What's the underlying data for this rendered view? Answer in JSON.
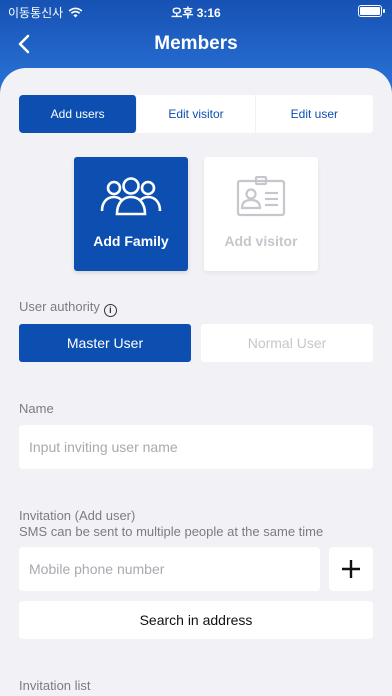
{
  "status_bar": {
    "carrier": "이동통신사",
    "time": "오후 3:16"
  },
  "header": {
    "title": "Members"
  },
  "tabs": [
    {
      "label": "Add users",
      "active": true
    },
    {
      "label": "Edit visitor",
      "active": false
    },
    {
      "label": "Edit user",
      "active": false
    }
  ],
  "cards": {
    "family": {
      "label": "Add Family",
      "icon": "family-icon"
    },
    "visitor": {
      "label": "Add visitor",
      "icon": "visitor-badge-icon"
    }
  },
  "authority": {
    "label": "User authority",
    "master_label": "Master User",
    "normal_label": "Normal User",
    "selected": "Master User"
  },
  "name_section": {
    "label": "Name",
    "placeholder": "Input inviting user name"
  },
  "invitation": {
    "label": "Invitation (Add user)",
    "description": "SMS can be sent to multiple people at the same time",
    "phone_placeholder": "Mobile phone number",
    "add_icon": "plus-icon",
    "address_button": "Search in address"
  },
  "invitation_list": {
    "label": "Invitation list"
  },
  "colors": {
    "primary": "#0c4fb0",
    "background": "#f2f2f6",
    "header": "#1b5fc2"
  }
}
